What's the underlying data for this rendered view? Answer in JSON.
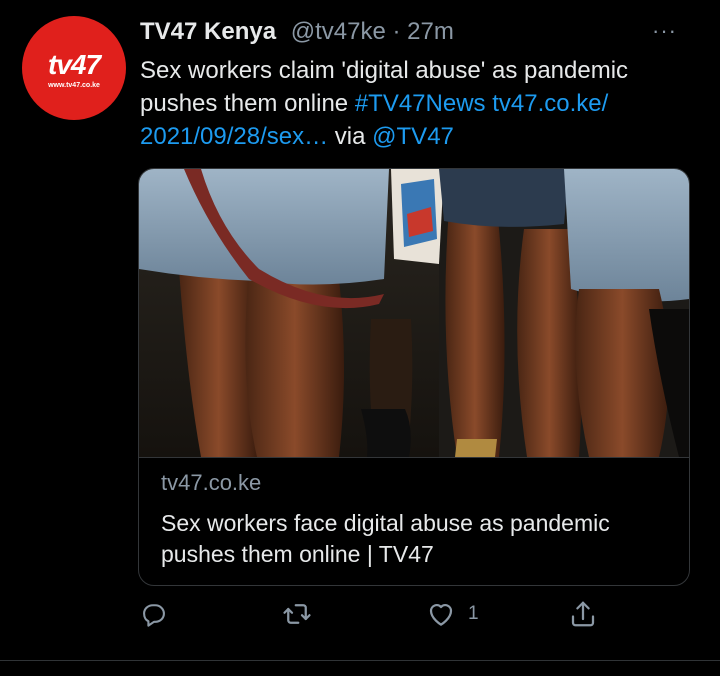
{
  "tweet": {
    "avatar": {
      "logo_text": "tv47",
      "url_text": "www.tv47.co.ke",
      "background": "#e0201c"
    },
    "display_name": "TV47 Kenya",
    "handle": "@tv47ke",
    "separator": " · ",
    "time": "27m",
    "more_icon": "···",
    "text_plain": "Sex workers claim 'digital abuse' as pandemic pushes them online ",
    "hashtag": "#TV47News",
    "link_text": "tv47.co.ke/​2021/09/28/sex…",
    "via_text": " via ",
    "mention": "@TV47"
  },
  "card": {
    "domain": "tv47.co.ke",
    "title": "Sex workers face digital abuse as pandemic pushes them online | TV47"
  },
  "actions": {
    "reply_icon": "reply-icon",
    "retweet_icon": "retweet-icon",
    "like_icon": "heart-icon",
    "like_count": "1",
    "share_icon": "share-icon"
  },
  "colors": {
    "background": "#000000",
    "text": "#e7e9ea",
    "secondary": "#8b98a5",
    "link": "#1d9bf0",
    "border": "#333639"
  }
}
